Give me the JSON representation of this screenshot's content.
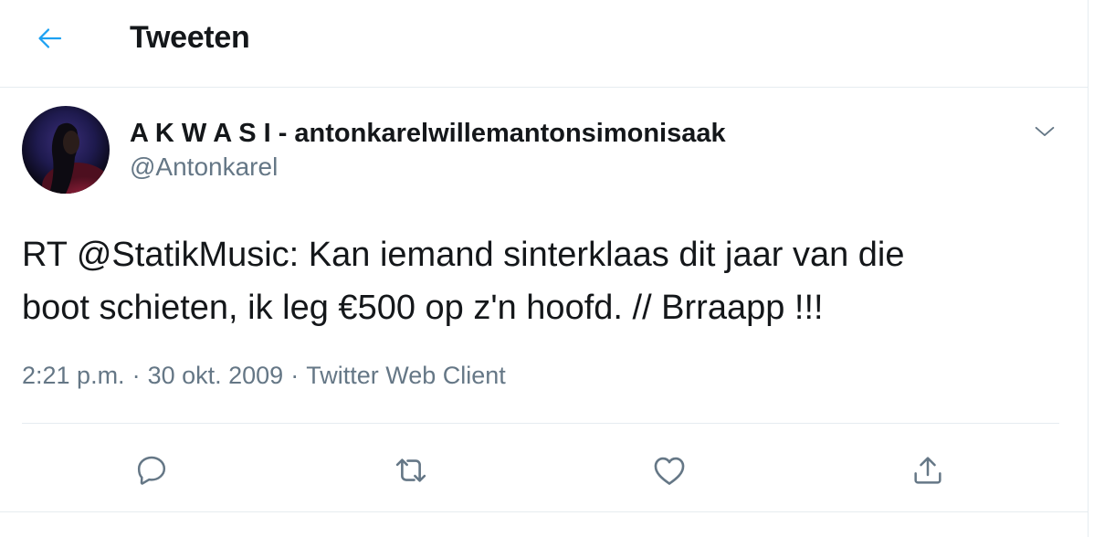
{
  "header": {
    "title": "Tweeten",
    "back_icon": "arrow-left-icon"
  },
  "tweet": {
    "display_name": "A K W A S I - antonkarelwillemantonsimonisaak",
    "handle": "@Antonkarel",
    "text_lines": [
      "RT @StatikMusic: Kan iemand sinterklaas dit jaar van die",
      "boot schieten, ik leg €500 op z'n hoofd. // Brraapp !!!"
    ],
    "time": "2:21 p.m.",
    "date": "30 okt. 2009",
    "source": "Twitter Web Client",
    "separator": "·"
  },
  "actions": {
    "reply_icon": "reply-icon",
    "retweet_icon": "retweet-icon",
    "like_icon": "heart-icon",
    "share_icon": "share-icon"
  },
  "colors": {
    "accent": "#1da1f2",
    "text": "#14171a",
    "secondary": "#657786",
    "border": "#e6ecf0"
  }
}
